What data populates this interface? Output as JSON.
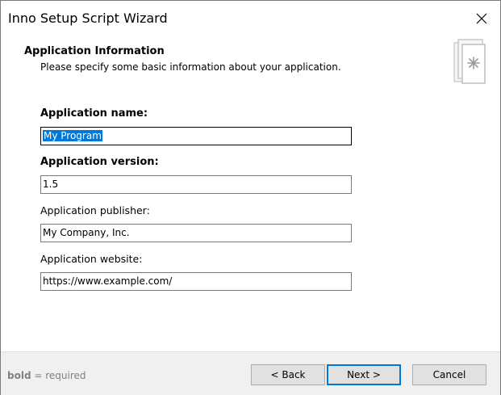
{
  "window": {
    "title": "Inno Setup Script Wizard"
  },
  "header": {
    "title": "Application Information",
    "subtitle": "Please specify some basic information about your application.",
    "icon": "wizard-page-icon"
  },
  "fields": [
    {
      "label": "Application name:",
      "required": true,
      "value": "My Program",
      "selected": true
    },
    {
      "label": "Application version:",
      "required": true,
      "value": "1.5",
      "selected": false
    },
    {
      "label": "Application publisher:",
      "required": false,
      "value": "My Company, Inc.",
      "selected": false
    },
    {
      "label": "Application website:",
      "required": false,
      "value": "https://www.example.com/",
      "selected": false
    }
  ],
  "footer": {
    "note_bold": "bold",
    "note_rest": " = required",
    "back_label": "< Back",
    "next_label": "Next >",
    "cancel_label": "Cancel"
  },
  "colors": {
    "selection": "#0078d7",
    "default_button_border": "#0078d7",
    "footer_bg": "#f0f0f0"
  }
}
